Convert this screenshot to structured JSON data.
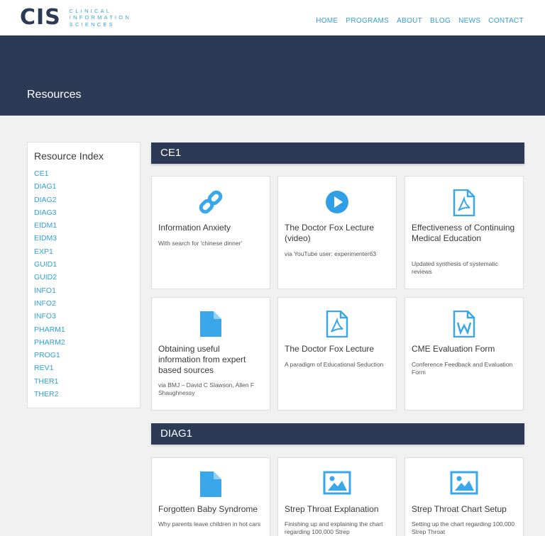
{
  "header": {
    "logo_mark": "CIS",
    "logo_lines": [
      "CLINICAL",
      "INFORMATION",
      "SCIENCES"
    ],
    "nav": [
      "HOME",
      "PROGRAMS",
      "ABOUT",
      "BLOG",
      "NEWS",
      "CONTACT"
    ]
  },
  "hero": {
    "title": "Resources"
  },
  "sidebar": {
    "title": "Resource Index",
    "items": [
      "CE1",
      "DIAG1",
      "DIAG2",
      "DIAG3",
      "EIDM1",
      "EIDM3",
      "EXP1",
      "GUID1",
      "GUID2",
      "INFO1",
      "INFO2",
      "INFO3",
      "PHARM1",
      "PHARM2",
      "PROG1",
      "REV1",
      "THER1",
      "THER2"
    ]
  },
  "sections": [
    {
      "title": "CE1",
      "cards": [
        {
          "icon": "link-icon",
          "title": "Information Anxiety",
          "sub": "With search for 'chinese dinner'"
        },
        {
          "icon": "play-icon",
          "title": "The Doctor Fox Lecture (video)",
          "sub": "via YouTube user: experimenter63"
        },
        {
          "icon": "pdf-icon",
          "title": "Effectiveness of Continuing Medical Education",
          "sub": "Updated synthesis of systematic reviews"
        },
        {
          "icon": "file-icon",
          "title": "Obtaining useful information from expert based sources",
          "sub": "via BMJ – David C Slawson, Allen F Shaughnessy"
        },
        {
          "icon": "pdf-icon",
          "title": "The Doctor Fox Lecture",
          "sub": "A paradigm of Educational Seduction"
        },
        {
          "icon": "word-icon",
          "title": "CME Evaluation Form",
          "sub": "Conference Feedback and Evaluation Form"
        }
      ]
    },
    {
      "title": "DIAG1",
      "cards": [
        {
          "icon": "file-icon",
          "title": "Forgotten Baby Syndrome",
          "sub": "Why parents leave children in hot cars"
        },
        {
          "icon": "image-icon",
          "title": "Strep Throat Explanation",
          "sub": "Finishing up and explaining the chart regarding 100,000 Strep"
        },
        {
          "icon": "image-icon",
          "title": "Strep Throat Chart Setup",
          "sub": "Setting up the chart regarding 100,000 Strep Throat"
        }
      ]
    }
  ],
  "colors": {
    "accent": "#2fa0da",
    "navy": "#2c3a55",
    "icon": "#3aa7ea"
  }
}
